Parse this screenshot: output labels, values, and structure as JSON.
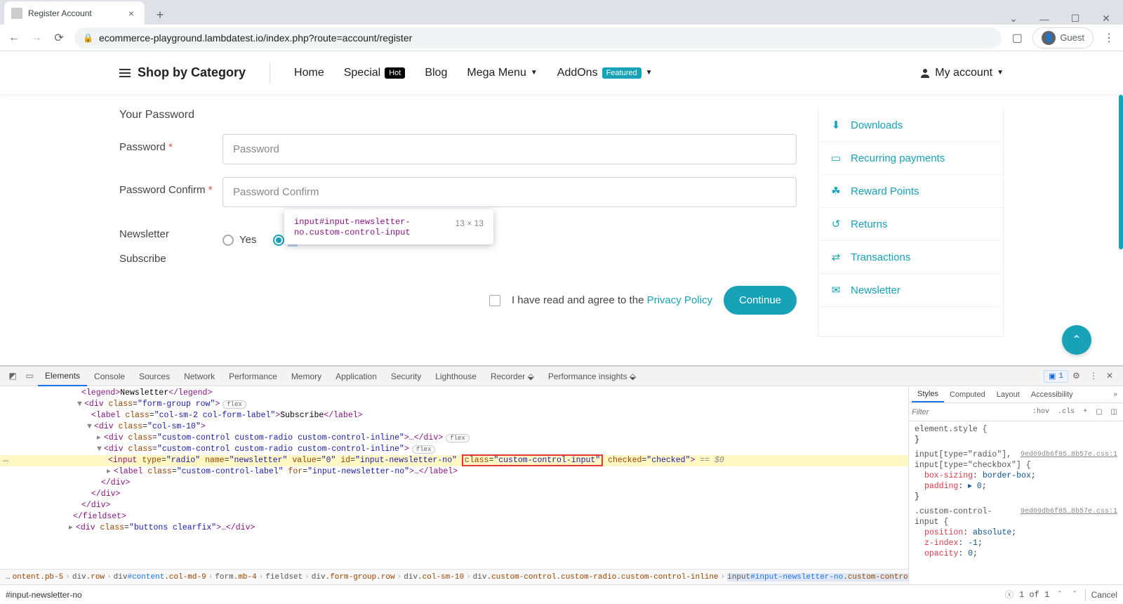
{
  "browser": {
    "tab_title": "Register Account",
    "url": "ecommerce-playground.lambdatest.io/index.php?route=account/register",
    "guest": "Guest"
  },
  "nav": {
    "shop_cat": "Shop by Category",
    "home": "Home",
    "special": "Special",
    "hot": "Hot",
    "blog": "Blog",
    "mega": "Mega Menu",
    "addons": "AddOns",
    "featured": "Featured",
    "account": "My account"
  },
  "form": {
    "section": "Your Password",
    "pw_label": "Password",
    "pw_placeholder": "Password",
    "pwc_label": "Password Confirm",
    "pwc_placeholder": "Password Confirm",
    "news_label": "Newsletter",
    "sub_label": "Subscribe",
    "yes": "Yes",
    "no": "No",
    "agree_prefix": "I have read and agree to the ",
    "agree_link": "Privacy Policy",
    "continue": "Continue"
  },
  "tooltip": {
    "selector": "input#input-newsletter-no.custom-control-input",
    "dims": "13 × 13"
  },
  "sidebar": {
    "items": [
      {
        "icon": "↓",
        "label": "Downloads"
      },
      {
        "icon": "≡",
        "label": "Recurring payments"
      },
      {
        "icon": "✪",
        "label": "Reward Points"
      },
      {
        "icon": "↺",
        "label": "Returns"
      },
      {
        "icon": "⇄",
        "label": "Transactions"
      },
      {
        "icon": "✉",
        "label": "Newsletter"
      }
    ]
  },
  "devtools": {
    "tabs": [
      "Elements",
      "Console",
      "Sources",
      "Network",
      "Performance",
      "Memory",
      "Application",
      "Security",
      "Lighthouse",
      "Recorder",
      "Performance insights"
    ],
    "issues": "1",
    "breadcrumb": [
      {
        "txt": "…"
      },
      {
        "txt": "ontent.pb-5",
        "cls": true
      },
      {
        "txt": "div.row",
        "cls": true
      },
      {
        "txt": "div#content.col-md-9",
        "id": true
      },
      {
        "txt": "form.mb-4",
        "cls": true
      },
      {
        "txt": "fieldset"
      },
      {
        "txt": "div.form-group.row",
        "cls": true
      },
      {
        "txt": "div.col-sm-10",
        "cls": true
      },
      {
        "txt": "div.custom-control.custom-radio.custom-control-inline",
        "cls": true
      },
      {
        "txt": "input#input-newsletter-no.custom-control-input",
        "id": true,
        "sel": true
      }
    ],
    "search_value": "#input-newsletter-no",
    "search_result": "1 of 1",
    "cancel": "Cancel",
    "styles_tabs": [
      "Styles",
      "Computed",
      "Layout",
      "Accessibility"
    ],
    "filter_ph": "Filter",
    "hov": ":hov",
    "cls": ".cls",
    "rules": {
      "elstyle": "element.style {",
      "r1_sel": "input[type=\"radio\"],",
      "r1_src": "9ed09db6f85…8b57e.css:1",
      "r1_sel2": "input[type=\"checkbox\"] {",
      "r1_p1": "box-sizing",
      "r1_v1": "border-box",
      "r1_p2": "padding",
      "r1_v2": "▸ 0",
      "r2_sel": ".custom-control-input {",
      "r2_src": "9ed09db6f85…8b57e.css:1",
      "r2_p1": "position",
      "r2_v1": "absolute",
      "r2_p2": "z-index",
      "r2_v2": "-1",
      "r2_p3": "opacity",
      "r2_v3": "0"
    }
  }
}
